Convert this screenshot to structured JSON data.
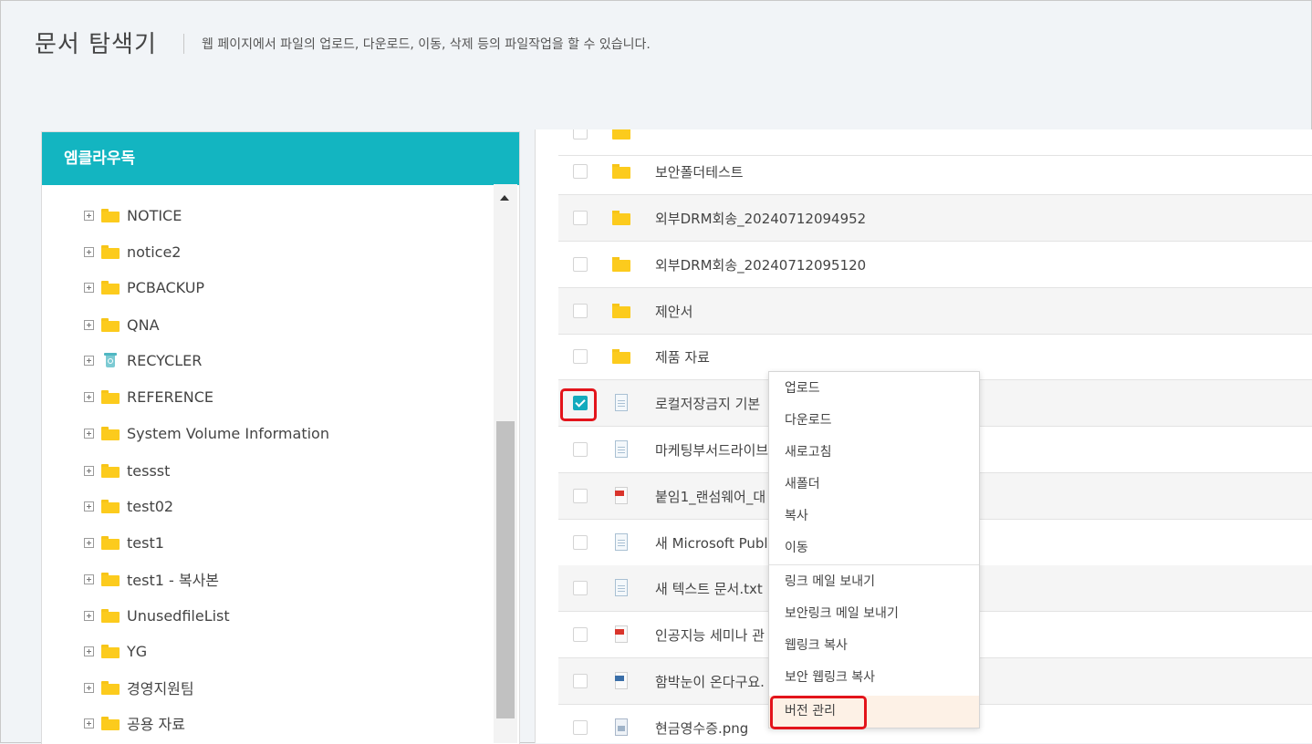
{
  "header": {
    "title": "문서 탐색기",
    "description": "웹 페이지에서 파일의 업로드, 다운로드, 이동, 삭제 등의 파일작업을 할 수 있습니다."
  },
  "tree": {
    "root_label": "엠클라우독",
    "items": [
      {
        "label": "NOTICE",
        "icon": "folder-icon"
      },
      {
        "label": "notice2",
        "icon": "folder-icon"
      },
      {
        "label": "PCBACKUP",
        "icon": "folder-icon"
      },
      {
        "label": "QNA",
        "icon": "folder-icon"
      },
      {
        "label": "RECYCLER",
        "icon": "recycle-bin-icon"
      },
      {
        "label": "REFERENCE",
        "icon": "folder-icon"
      },
      {
        "label": "System Volume Information",
        "icon": "folder-icon"
      },
      {
        "label": "tessst",
        "icon": "folder-icon"
      },
      {
        "label": "test02",
        "icon": "folder-icon"
      },
      {
        "label": "test1",
        "icon": "folder-icon"
      },
      {
        "label": "test1 - 복사본",
        "icon": "folder-icon"
      },
      {
        "label": "UnusedfileList",
        "icon": "folder-icon"
      },
      {
        "label": "YG",
        "icon": "folder-icon"
      },
      {
        "label": "경영지원팀",
        "icon": "folder-icon"
      },
      {
        "label": "공용 자료",
        "icon": "folder-icon"
      }
    ]
  },
  "files": [
    {
      "name": "보안폴더테스트",
      "type": "folder",
      "checked": false
    },
    {
      "name": "외부DRM회송_20240712094952",
      "type": "folder",
      "checked": false
    },
    {
      "name": "외부DRM회송_20240712095120",
      "type": "folder",
      "checked": false
    },
    {
      "name": "제안서",
      "type": "folder",
      "checked": false
    },
    {
      "name": "제품 자료",
      "type": "folder",
      "checked": false
    },
    {
      "name": "로컬저장금지 기본",
      "type": "doc",
      "checked": true
    },
    {
      "name": "마케팅부서드라이브",
      "type": "doc",
      "checked": false
    },
    {
      "name": "붙임1_랜섬웨어_대",
      "type": "pdf",
      "checked": false
    },
    {
      "name": "새 Microsoft Publ",
      "type": "doc",
      "checked": false
    },
    {
      "name": "새 텍스트 문서.txt",
      "type": "doc",
      "checked": false
    },
    {
      "name": "인공지능 세미나 관",
      "type": "pdf",
      "checked": false
    },
    {
      "name": "함박눈이 온다구요.",
      "type": "img",
      "checked": false
    },
    {
      "name": "현금영수증.png",
      "type": "png",
      "checked": false
    }
  ],
  "context_menu": {
    "items": [
      "업로드",
      "다운로드",
      "새로고침",
      "새폴더",
      "복사",
      "이동",
      "링크 메일 보내기",
      "보안링크 메일 보내기",
      "웹링크 복사",
      "보안 웹링크 복사",
      "버전 관리"
    ],
    "highlighted": "버전 관리"
  },
  "colors": {
    "accent": "#13b5c1",
    "highlight_box": "#e3141b",
    "folder": "#fccb1d"
  }
}
